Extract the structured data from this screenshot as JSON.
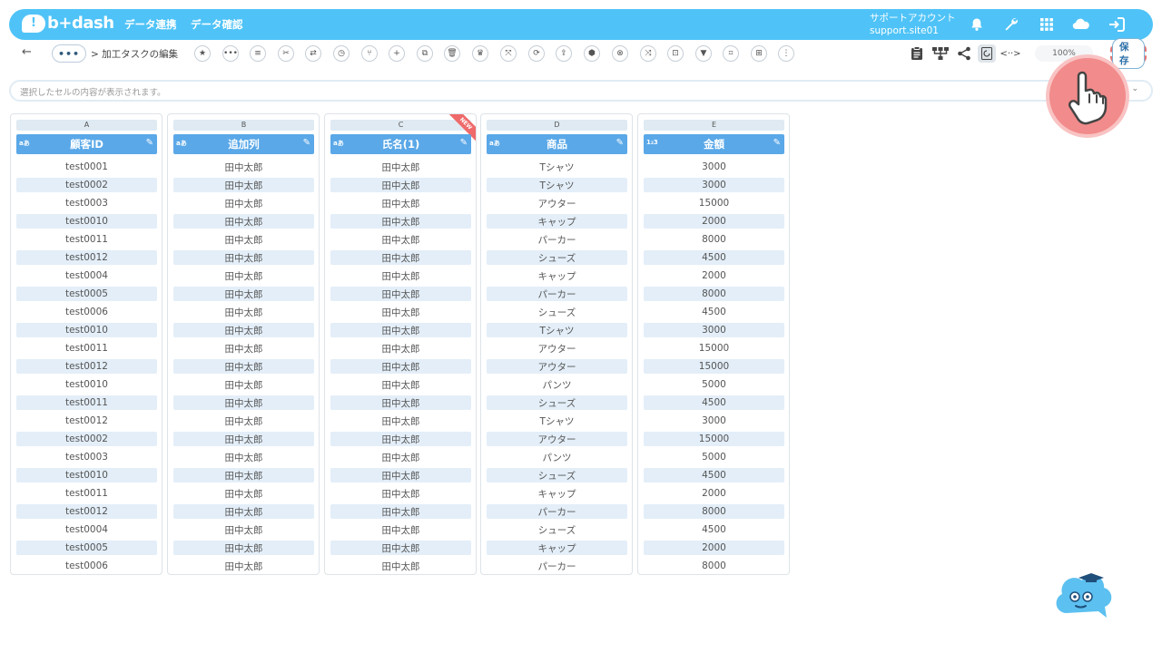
{
  "app": {
    "logo_mark": "!",
    "logo_text": "b+dash",
    "nav": [
      "データ連携",
      "データ確認"
    ],
    "account_name": "サポートアカウント",
    "account_site": "support.site01"
  },
  "toolbar": {
    "back_icon": "←",
    "more_label": "•••",
    "breadcrumb": "> 加工タスクの編集",
    "tools": [
      "★",
      "•••",
      "≡",
      "✂",
      "⇄",
      "◷",
      "⑂",
      "+",
      "⧉",
      "🗑",
      "♛",
      "⤧",
      "⟳",
      "⇪",
      "⬢",
      "⊗",
      "⤨",
      "⊡",
      "▼",
      "⌗",
      "⊞",
      "⋮"
    ],
    "zoom": "100%",
    "save_label": "保存"
  },
  "cellbar": {
    "placeholder": "選択したセルの内容が表示されます。"
  },
  "columns": [
    {
      "letter": "A",
      "type": "aあ",
      "name": "顧客ID",
      "is_new": false,
      "values": [
        "test0001",
        "test0002",
        "test0003",
        "test0010",
        "test0011",
        "test0012",
        "test0004",
        "test0005",
        "test0006",
        "test0010",
        "test0011",
        "test0012",
        "test0010",
        "test0011",
        "test0012",
        "test0002",
        "test0003",
        "test0010",
        "test0011",
        "test0012",
        "test0004",
        "test0005",
        "test0006"
      ]
    },
    {
      "letter": "B",
      "type": "aあ",
      "name": "追加列",
      "is_new": false,
      "values": [
        "田中太郎",
        "田中太郎",
        "田中太郎",
        "田中太郎",
        "田中太郎",
        "田中太郎",
        "田中太郎",
        "田中太郎",
        "田中太郎",
        "田中太郎",
        "田中太郎",
        "田中太郎",
        "田中太郎",
        "田中太郎",
        "田中太郎",
        "田中太郎",
        "田中太郎",
        "田中太郎",
        "田中太郎",
        "田中太郎",
        "田中太郎",
        "田中太郎",
        "田中太郎"
      ]
    },
    {
      "letter": "C",
      "type": "aあ",
      "name": "氏名(1)",
      "is_new": true,
      "new_label": "NEW",
      "values": [
        "田中太郎",
        "田中太郎",
        "田中太郎",
        "田中太郎",
        "田中太郎",
        "田中太郎",
        "田中太郎",
        "田中太郎",
        "田中太郎",
        "田中太郎",
        "田中太郎",
        "田中太郎",
        "田中太郎",
        "田中太郎",
        "田中太郎",
        "田中太郎",
        "田中太郎",
        "田中太郎",
        "田中太郎",
        "田中太郎",
        "田中太郎",
        "田中太郎",
        "田中太郎"
      ]
    },
    {
      "letter": "D",
      "type": "aあ",
      "name": "商品",
      "is_new": false,
      "values": [
        "Tシャツ",
        "Tシャツ",
        "アウター",
        "キャップ",
        "パーカー",
        "シューズ",
        "キャップ",
        "パーカー",
        "シューズ",
        "Tシャツ",
        "アウター",
        "アウター",
        "パンツ",
        "シューズ",
        "Tシャツ",
        "アウター",
        "パンツ",
        "シューズ",
        "キャップ",
        "パーカー",
        "シューズ",
        "キャップ",
        "パーカー"
      ]
    },
    {
      "letter": "E",
      "type": "1₂3",
      "name": "金額",
      "is_new": false,
      "values": [
        "3000",
        "3000",
        "15000",
        "2000",
        "8000",
        "4500",
        "2000",
        "8000",
        "4500",
        "3000",
        "15000",
        "15000",
        "5000",
        "4500",
        "3000",
        "15000",
        "5000",
        "4500",
        "2000",
        "8000",
        "4500",
        "2000",
        "8000"
      ]
    }
  ],
  "colors": {
    "brand": "#4fc3f7",
    "header": "#5aa8e8",
    "row_alt": "#e3eef8",
    "accent": "#ef6a6a"
  }
}
